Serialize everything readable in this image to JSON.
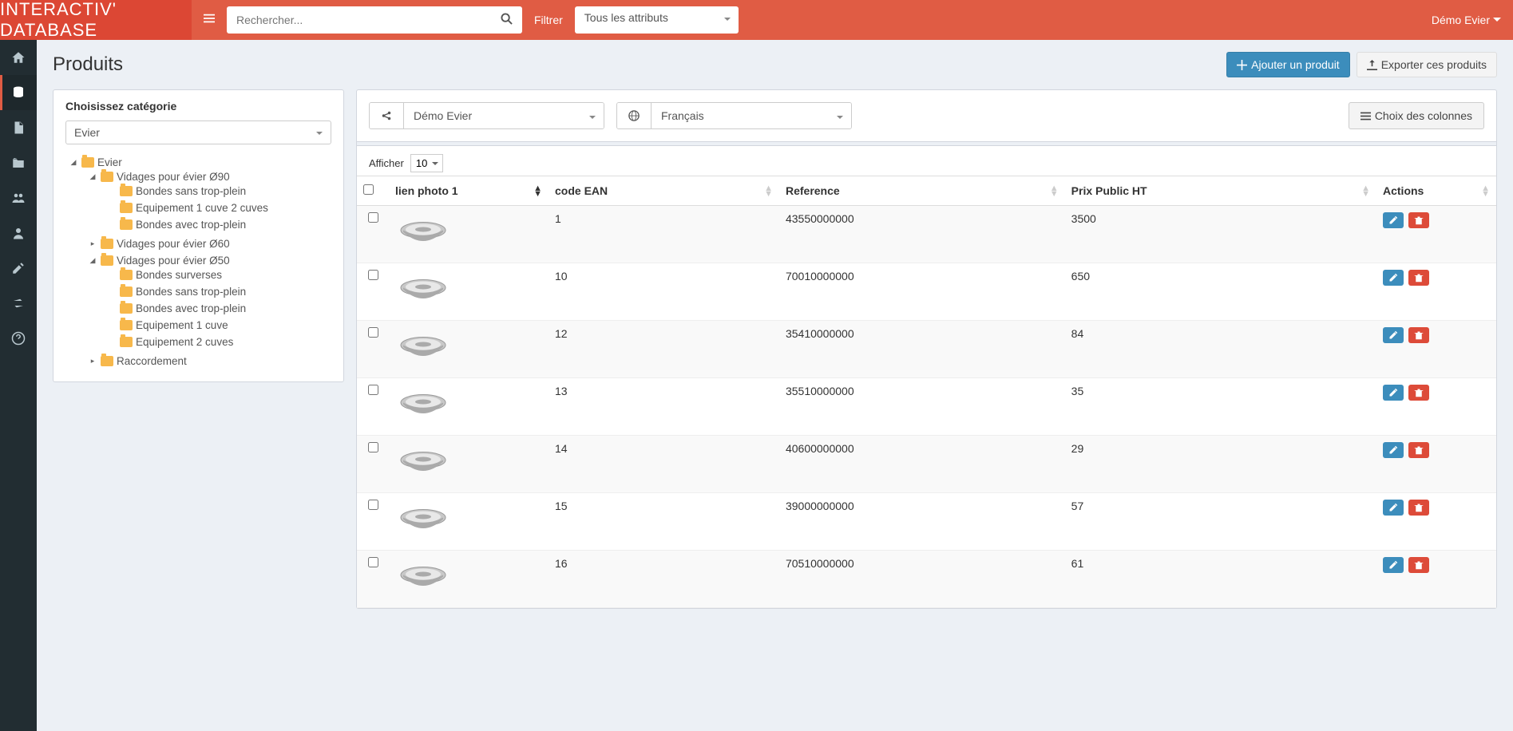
{
  "header": {
    "logo": "INTERACTIV' DATABASE",
    "search_placeholder": "Rechercher...",
    "filter_label": "Filtrer",
    "filter_value": "Tous les attributs",
    "user_label": "Démo Evier"
  },
  "page": {
    "title": "Produits",
    "add_button": "Ajouter un produit",
    "export_button": "Exporter ces produits"
  },
  "category": {
    "title": "Choisissez catégorie",
    "select_value": "Evier",
    "tree": {
      "root": "Evier",
      "items_90": {
        "label": "Vidages pour évier Ø90",
        "children": [
          "Bondes sans trop-plein",
          "Equipement 1 cuve 2 cuves",
          "Bondes avec trop-plein"
        ]
      },
      "item_60": "Vidages pour évier Ø60",
      "items_50": {
        "label": "Vidages pour évier Ø50",
        "children": [
          "Bondes surverses",
          "Bondes sans trop-plein",
          "Bondes avec trop-plein",
          "Equipement 1 cuve",
          "Equipement 2 cuves"
        ]
      },
      "item_raccord": "Raccordement"
    }
  },
  "toolbar": {
    "share_value": "Démo Evier",
    "lang_value": "Français",
    "columns_button": "Choix des colonnes",
    "afficher_label": "Afficher",
    "afficher_value": "10"
  },
  "table": {
    "columns": {
      "photo": "lien photo 1",
      "ean": "code EAN",
      "ref": "Reference",
      "price": "Prix Public HT",
      "actions": "Actions"
    },
    "rows": [
      {
        "ean": "1",
        "ref": "43550000000",
        "price": "3500"
      },
      {
        "ean": "10",
        "ref": "70010000000",
        "price": "650"
      },
      {
        "ean": "12",
        "ref": "35410000000",
        "price": "84"
      },
      {
        "ean": "13",
        "ref": "35510000000",
        "price": "35"
      },
      {
        "ean": "14",
        "ref": "40600000000",
        "price": "29"
      },
      {
        "ean": "15",
        "ref": "39000000000",
        "price": "57"
      },
      {
        "ean": "16",
        "ref": "70510000000",
        "price": "61"
      }
    ]
  }
}
